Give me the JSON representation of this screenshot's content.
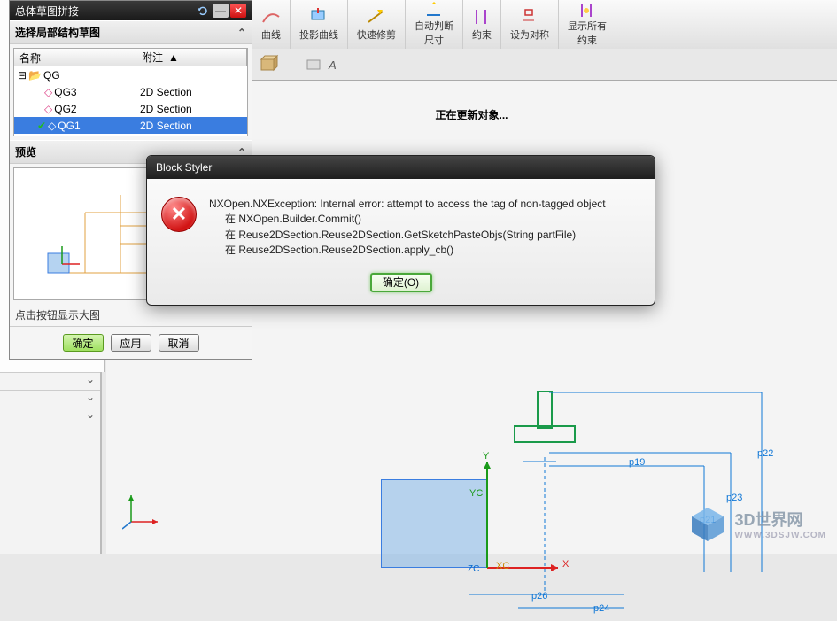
{
  "ribbon": {
    "items": [
      {
        "label": "曲线"
      },
      {
        "label": "投影曲线"
      },
      {
        "label": "快速修剪"
      },
      {
        "label": "自动判断\n尺寸"
      },
      {
        "label": "约束"
      },
      {
        "label": "设为对称"
      },
      {
        "label": "显示所有\n约束"
      }
    ]
  },
  "palette": {
    "title": "总体草图拼接",
    "section1": "选择局部结构草图",
    "tree": {
      "col1": "名称",
      "col2": "附注",
      "root": "QG",
      "rows": [
        {
          "name": "QG3",
          "note": "2D Section",
          "sel": false
        },
        {
          "name": "QG2",
          "note": "2D Section",
          "sel": false
        },
        {
          "name": "QG1",
          "note": "2D Section",
          "sel": true
        }
      ]
    },
    "section2": "预览",
    "caption": "点击按钮显示大图",
    "buttons": {
      "ok": "确定",
      "apply": "应用",
      "cancel": "取消"
    }
  },
  "dialog": {
    "title": "Block Styler",
    "line1": "NXOpen.NXException: Internal error: attempt to access the tag of non-tagged object",
    "line2": "在 NXOpen.Builder.Commit()",
    "line3": "在 Reuse2DSection.Reuse2DSection.GetSketchPasteObjs(String partFile)",
    "line4": "在 Reuse2DSection.Reuse2DSection.apply_cb()",
    "ok": "确定(O)"
  },
  "status": "正在更新对象...",
  "dims": {
    "p19": "p19",
    "p21": "p21",
    "p22": "p22",
    "p23": "p23",
    "p24": "p24",
    "p26": "p26"
  },
  "axes": {
    "x": "X",
    "y": "Y",
    "xc": "XC",
    "yc": "YC",
    "zc": "ZC"
  },
  "watermark": {
    "name": "3D世界网",
    "url": "WWW.3DSJW.COM"
  }
}
